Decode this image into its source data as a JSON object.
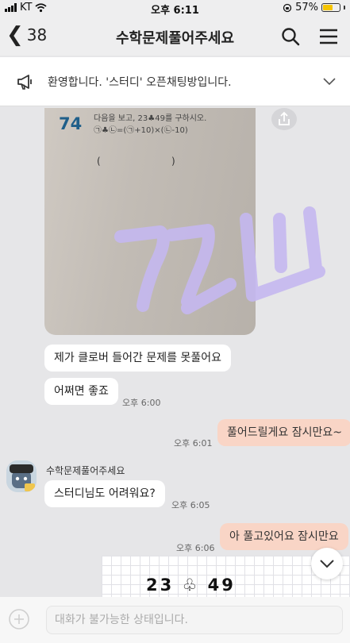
{
  "status_bar": {
    "carrier": "KT",
    "time": "오후 6:11",
    "battery": "57%"
  },
  "header": {
    "back_count": "38",
    "title": "수학문제풀어주세요",
    "icons": [
      "search-icon",
      "menu-icon"
    ]
  },
  "notice": {
    "text": "환영합니다. '스터디' 오픈채팅방입니다."
  },
  "photo": {
    "problem_number": "74",
    "question_line1": "다음을 보고, 23♣49를 구하시오.",
    "question_line2": "㉠♣㉡=(㉠+10)×(㉡-10)",
    "paren_left": "(",
    "paren_right": ")"
  },
  "messages": [
    {
      "text": "제가 클로버 들어간 문제를 못풀어요",
      "side": "in"
    },
    {
      "text": "어쩌면 좋죠",
      "side": "in",
      "time": "오후 6:00"
    },
    {
      "text": "풀어드릴게요 잠시만요~",
      "side": "out",
      "time": "오후 6:01"
    },
    {
      "sender": "수학문제풀어주세요",
      "text": "스터디님도 어려워요?",
      "side": "in",
      "time": "오후 6:05"
    },
    {
      "text": "아 풀고있어요 잠시만요",
      "side": "out",
      "time": "오후 6:06"
    }
  ],
  "card": {
    "text": "23 ♧ 49"
  },
  "input": {
    "placeholder": "대화가 불가능한 상태입니다."
  },
  "colors": {
    "outgoing_bubble": "#f9d5c6",
    "incoming_bubble": "#ffffff",
    "background": "#e6e6e8"
  }
}
